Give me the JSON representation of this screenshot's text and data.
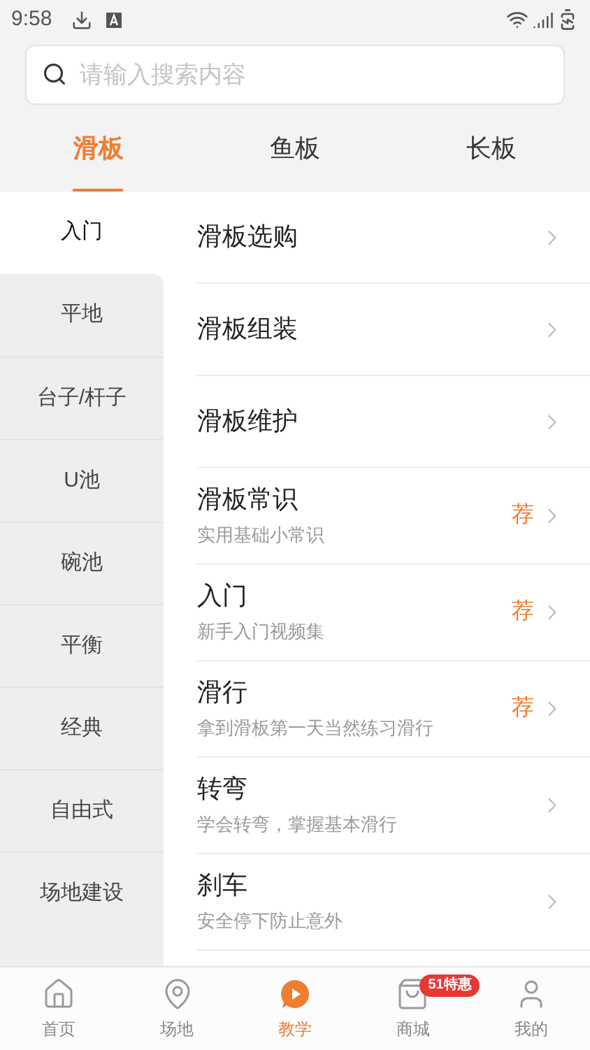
{
  "status_bar": {
    "time": "9:58"
  },
  "search": {
    "placeholder": "请输入搜索内容"
  },
  "tabs": [
    {
      "label": "滑板",
      "selected": true
    },
    {
      "label": "鱼板",
      "selected": false
    },
    {
      "label": "长板",
      "selected": false
    }
  ],
  "sidebar": {
    "items": [
      {
        "label": "入门",
        "selected": true
      },
      {
        "label": "平地",
        "selected": false
      },
      {
        "label": "台子/杆子",
        "selected": false
      },
      {
        "label": "U池",
        "selected": false
      },
      {
        "label": "碗池",
        "selected": false
      },
      {
        "label": "平衡",
        "selected": false
      },
      {
        "label": "经典",
        "selected": false
      },
      {
        "label": "自由式",
        "selected": false
      },
      {
        "label": "场地建设",
        "selected": false
      }
    ]
  },
  "list": [
    {
      "title": "滑板选购"
    },
    {
      "title": "滑板组装"
    },
    {
      "title": "滑板维护"
    },
    {
      "title": "滑板常识",
      "subtitle": "实用基础小常识",
      "tag": "荐"
    },
    {
      "title": "入门",
      "subtitle": "新手入门视频集",
      "tag": "荐"
    },
    {
      "title": "滑行",
      "subtitle": "拿到滑板第一天当然练习滑行",
      "tag": "荐"
    },
    {
      "title": "转弯",
      "subtitle": "学会转弯，掌握基本滑行"
    },
    {
      "title": "刹车",
      "subtitle": "安全停下防止意外"
    }
  ],
  "bottom_nav": [
    {
      "label": "首页",
      "selected": false
    },
    {
      "label": "场地",
      "selected": false
    },
    {
      "label": "教学",
      "selected": true
    },
    {
      "label": "商城",
      "selected": false,
      "badge": "51特惠"
    },
    {
      "label": "我的",
      "selected": false
    }
  ]
}
